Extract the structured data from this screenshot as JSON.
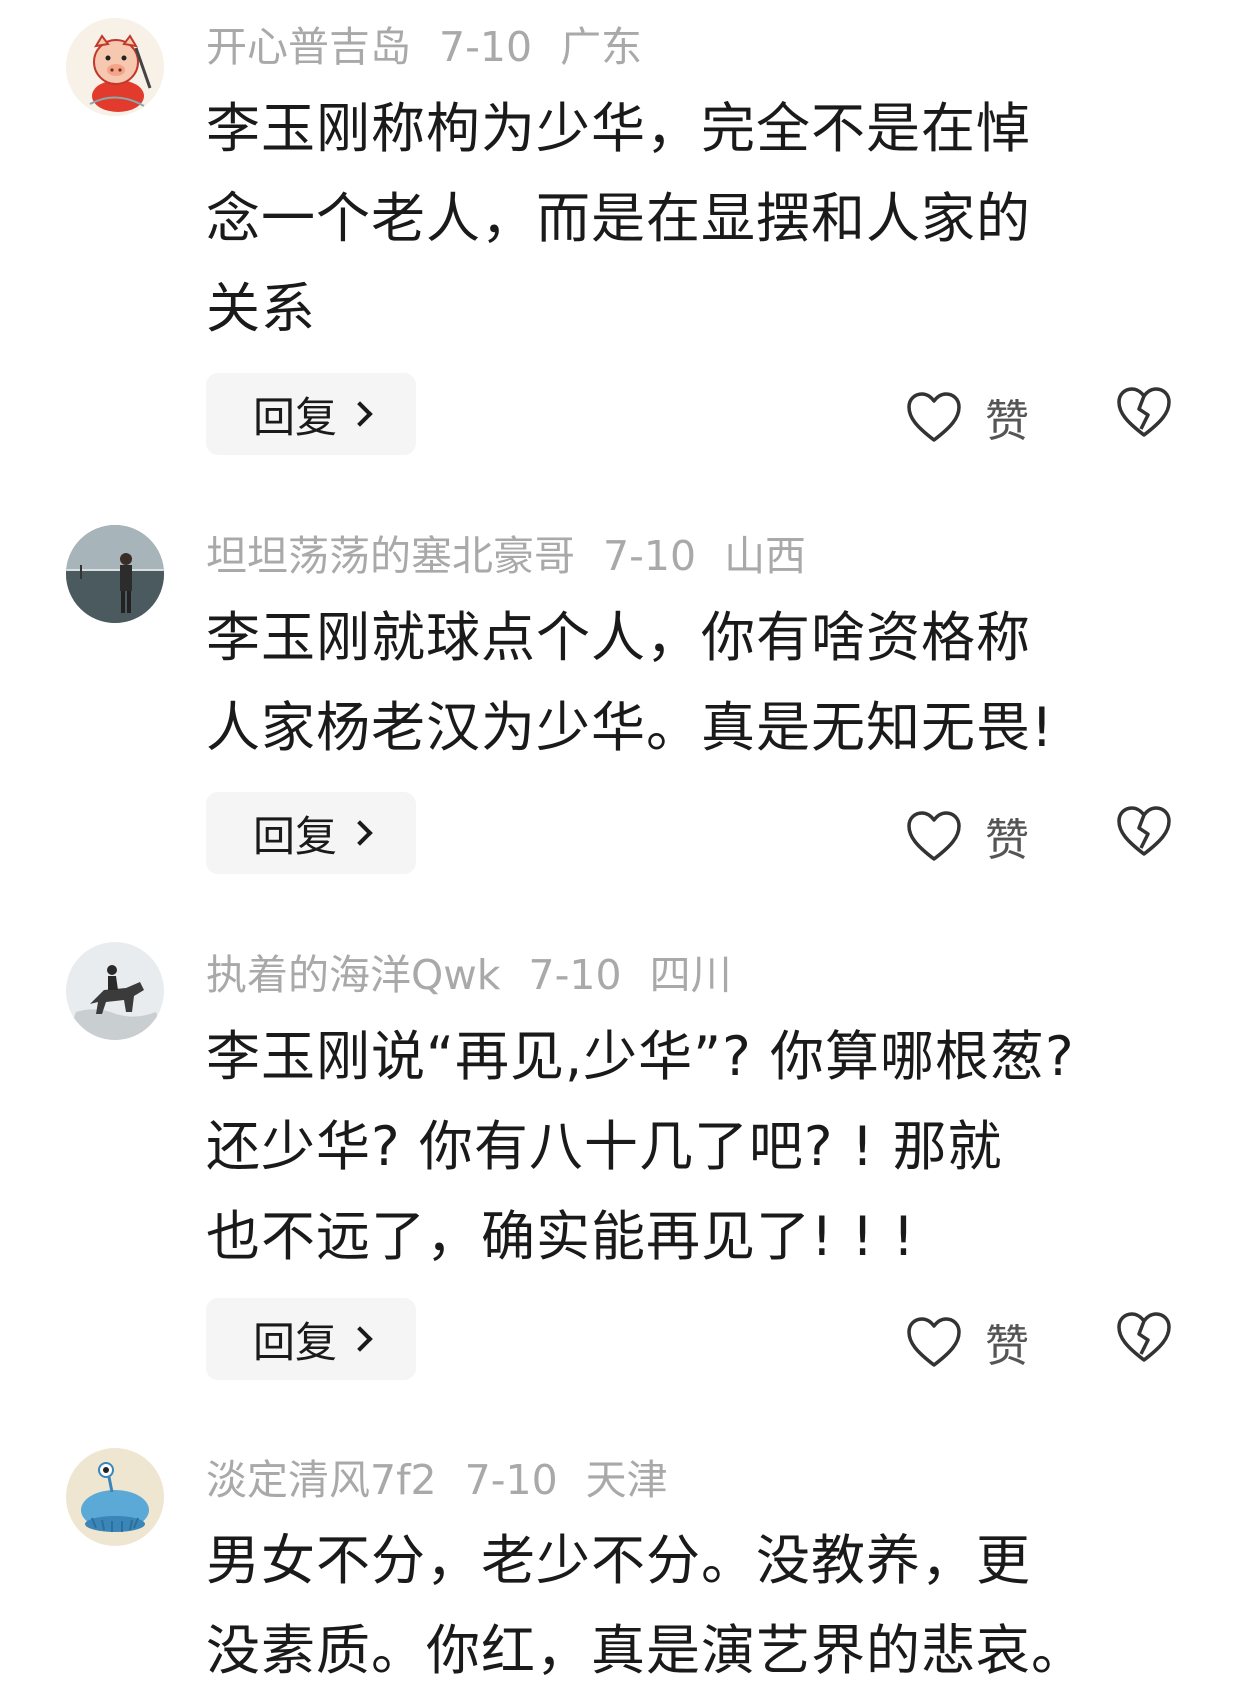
{
  "actions": {
    "reply_label": "回复",
    "like_label": "赞"
  },
  "comments": [
    {
      "username": "开心普吉岛",
      "date": "7-10",
      "location": "广东",
      "avatar_icon": "cartoon-pig-avatar",
      "lines": [
        "李玉刚称枸为少华，完全不是在悼",
        "念一个老人，而是在显摆和人家的",
        "关系"
      ]
    },
    {
      "username": "坦坦荡荡的塞北豪哥",
      "date": "7-10",
      "location": "山西",
      "avatar_icon": "person-photo-avatar",
      "lines": [
        "李玉刚就球点个人，你有啥资格称",
        "人家杨老汉为少华。真是无知无畏!"
      ]
    },
    {
      "username": "执着的海洋Qwk",
      "date": "7-10",
      "location": "四川",
      "avatar_icon": "horse-rider-avatar",
      "lines": [
        "李玉刚说“再见,少华”? 你算哪根葱?",
        "还少华? 你有八十几了吧? ! 那就",
        "也不远了，确实能再见了! ! !"
      ]
    },
    {
      "username": "淡定清风7f2",
      "date": "7-10",
      "location": "天津",
      "avatar_icon": "blue-alien-avatar",
      "lines": [
        "男女不分，老少不分。没教养，更",
        "没素质。你红，真是演艺界的悲哀。"
      ]
    }
  ]
}
